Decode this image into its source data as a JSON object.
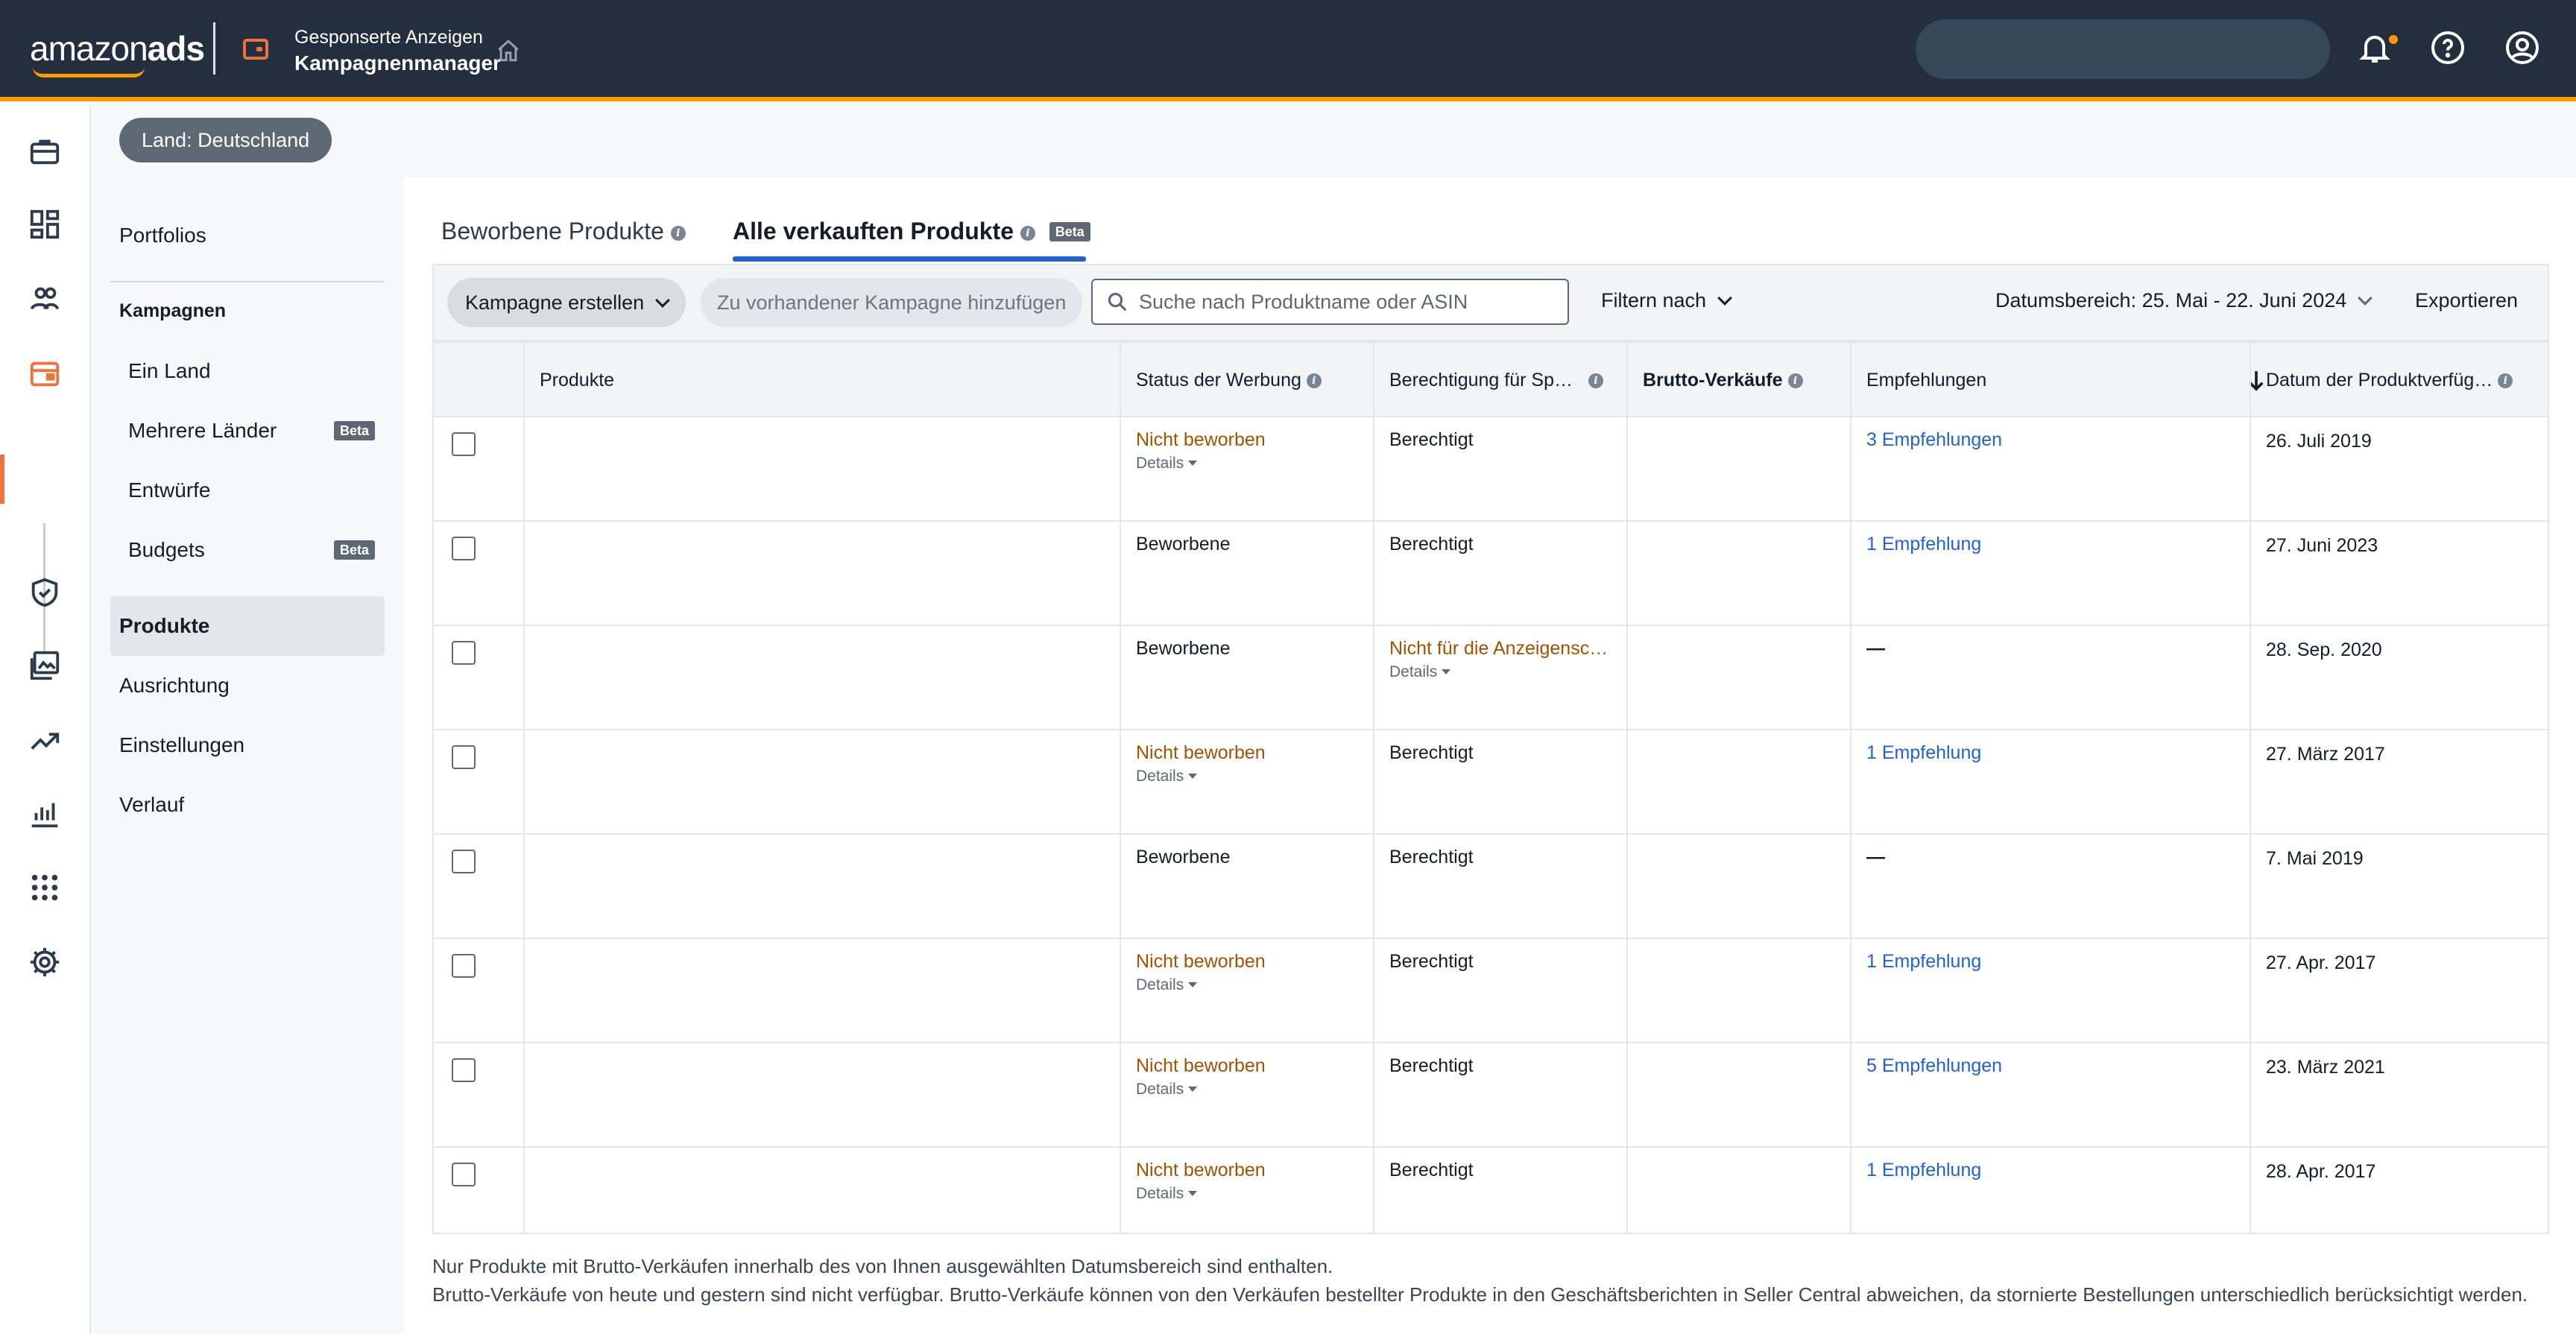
{
  "header": {
    "brand_regular": "amazon",
    "brand_bold": "ads",
    "product_label": "Gesponserte Anzeigen",
    "page_label": "Kampagnenmanager"
  },
  "country_chip": "Land: Deutschland",
  "subnav": {
    "portfolios": "Portfolios",
    "campaigns_heading": "Kampagnen",
    "one_country": "Ein Land",
    "multi_country": "Mehrere Länder",
    "drafts": "Entwürfe",
    "budgets": "Budgets",
    "products": "Produkte",
    "targeting": "Ausrichtung",
    "settings": "Einstellungen",
    "history": "Verlauf",
    "beta": "Beta"
  },
  "tabs": {
    "advertised": "Beworbene Produkte",
    "all_sold": "Alle verkauften Produkte",
    "beta": "Beta"
  },
  "toolbar": {
    "create_campaign": "Kampagne erstellen",
    "add_to_existing": "Zu vorhandener Kampagne hinzufügen",
    "search_placeholder": "Suche nach Produktname oder ASIN",
    "filter_by": "Filtern nach",
    "date_range": "Datumsbereich: 25. Mai - 22. Juni 2024",
    "export": "Exportieren"
  },
  "table": {
    "columns": {
      "products": "Produkte",
      "ad_status": "Status der Werbung",
      "eligibility": "Berechtigung für Sp…",
      "gross_sales": "Brutto-Verkäufe",
      "recommendations": "Empfehlungen",
      "availability_date": "Datum der Produktverfüg…"
    },
    "details_label": "Details",
    "rows": [
      {
        "status": "Nicht beworben",
        "status_warn": true,
        "eligibility": "Berechtigt",
        "elig_warn": false,
        "recommendation": "3 Empfehlungen",
        "date": "26. Juli 2019"
      },
      {
        "status": "Beworbene",
        "status_warn": false,
        "eligibility": "Berechtigt",
        "elig_warn": false,
        "recommendation": "1 Empfehlung",
        "date": "27. Juni 2023"
      },
      {
        "status": "Beworbene",
        "status_warn": false,
        "eligibility": "Nicht für die Anzeigensc…",
        "elig_warn": true,
        "recommendation": "—",
        "date": "28. Sep. 2020"
      },
      {
        "status": "Nicht beworben",
        "status_warn": true,
        "eligibility": "Berechtigt",
        "elig_warn": false,
        "recommendation": "1 Empfehlung",
        "date": "27. März 2017"
      },
      {
        "status": "Beworbene",
        "status_warn": false,
        "eligibility": "Berechtigt",
        "elig_warn": false,
        "recommendation": "—",
        "date": "7. Mai 2019"
      },
      {
        "status": "Nicht beworben",
        "status_warn": true,
        "eligibility": "Berechtigt",
        "elig_warn": false,
        "recommendation": "1 Empfehlung",
        "date": "27. Apr. 2017"
      },
      {
        "status": "Nicht beworben",
        "status_warn": true,
        "eligibility": "Berechtigt",
        "elig_warn": false,
        "recommendation": "5 Empfehlungen",
        "date": "23. März 2021"
      },
      {
        "status": "Nicht beworben",
        "status_warn": true,
        "eligibility": "Berechtigt",
        "elig_warn": false,
        "recommendation": "1 Empfehlung",
        "date": "28. Apr. 2017"
      }
    ]
  },
  "notes": {
    "line1": "Nur Produkte mit Brutto-Verkäufen innerhalb des von Ihnen ausgewählten Datumsbereich sind enthalten.",
    "line2": "Brutto-Verkäufe von heute und gestern sind nicht verfügbar. Brutto-Verkäufe können von den Verkäufen bestellter Produkte in den Geschäftsberichten in Seller Central abweichen, da stornierte Bestellungen unterschiedlich berücksichtigt werden."
  },
  "colors": {
    "topbar": "#232f3e",
    "accent_orange": "#ff9900",
    "rail_active": "#f1713b",
    "link_blue": "#2162d1",
    "warn_text": "#a35200"
  }
}
